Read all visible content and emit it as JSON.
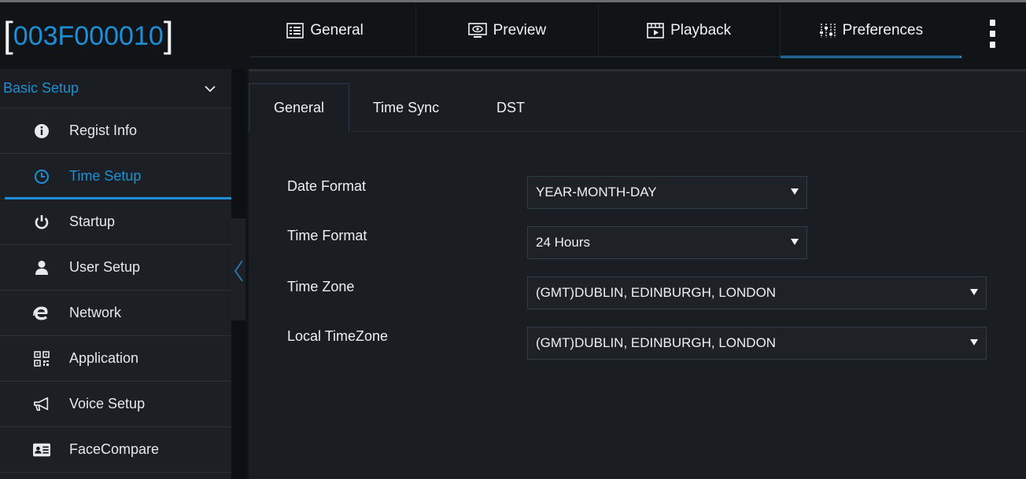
{
  "device": {
    "id": "003F000010"
  },
  "top_tabs": [
    {
      "label": "General",
      "icon": "general-icon"
    },
    {
      "label": "Preview",
      "icon": "preview-icon"
    },
    {
      "label": "Playback",
      "icon": "playback-icon"
    },
    {
      "label": "Preferences",
      "icon": "preferences-icon",
      "active": true
    }
  ],
  "sidebar": {
    "section": "Basic Setup",
    "items": [
      {
        "label": "Regist Info",
        "icon": "info-icon"
      },
      {
        "label": "Time Setup",
        "icon": "clock-icon",
        "active": true
      },
      {
        "label": "Startup",
        "icon": "power-icon"
      },
      {
        "label": "User Setup",
        "icon": "user-icon"
      },
      {
        "label": "Network",
        "icon": "ie-network-icon"
      },
      {
        "label": "Application",
        "icon": "qr-application-icon"
      },
      {
        "label": "Voice Setup",
        "icon": "megaphone-icon"
      },
      {
        "label": "FaceCompare",
        "icon": "id-card-icon"
      }
    ]
  },
  "sub_tabs": [
    {
      "label": "General",
      "active": true
    },
    {
      "label": "Time Sync"
    },
    {
      "label": "DST"
    }
  ],
  "form": {
    "date_format": {
      "label": "Date Format",
      "value": "YEAR-MONTH-DAY"
    },
    "time_format": {
      "label": "Time Format",
      "value": "24 Hours"
    },
    "time_zone": {
      "label": "Time Zone",
      "value": "(GMT)DUBLIN, EDINBURGH, LONDON"
    },
    "local_time_zone": {
      "label": "Local TimeZone",
      "value": "(GMT)DUBLIN, EDINBURGH, LONDON"
    }
  },
  "colors": {
    "accent": "#1e8fd6",
    "background": "#111417",
    "panel": "#1a1d21",
    "sidebar": "#1c2024"
  }
}
